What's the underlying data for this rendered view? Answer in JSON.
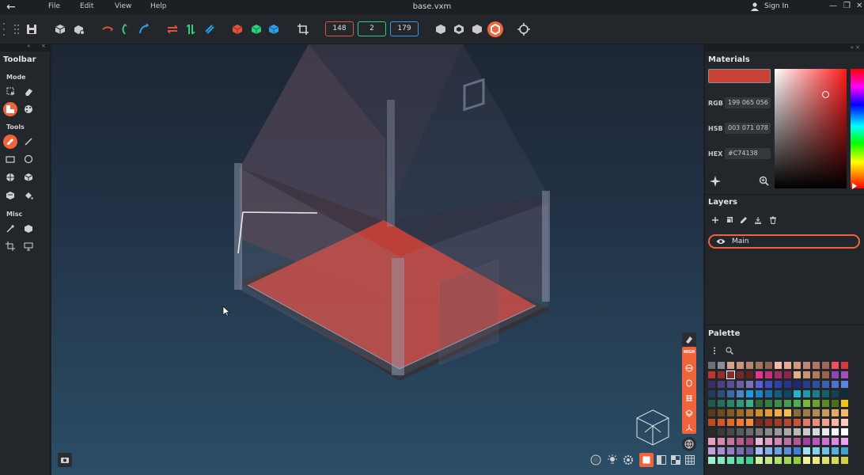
{
  "app": {
    "title": "base.vxm",
    "menu": [
      "File",
      "Edit",
      "View",
      "Help"
    ],
    "signin_label": "Sign In"
  },
  "top_toolbar": {
    "dims": {
      "x": "148",
      "y": "2",
      "z": "179"
    },
    "dim_colors": {
      "x": "#e0533a",
      "y": "#2fcf7c",
      "z": "#2f9ee8"
    }
  },
  "left_toolbar": {
    "heading": "Toolbar",
    "sections": {
      "mode": "Mode",
      "tools": "Tools",
      "misc": "Misc"
    }
  },
  "materials": {
    "heading": "Materials",
    "current_color": "#C74138",
    "rgb_label": "RGB",
    "rgb_value": "199 065 056",
    "hsb_label": "HSB",
    "hsb_value": "003 071 078",
    "hex_label": "HEX",
    "hex_value": "#C74138"
  },
  "layers": {
    "heading": "Layers",
    "items": [
      {
        "name": "Main"
      }
    ]
  },
  "palette": {
    "heading": "Palette",
    "selected_index": 17,
    "colors": [
      "#6b6f78",
      "#8a8d94",
      "#d1a38c",
      "#c8947c",
      "#b9846e",
      "#a37560",
      "#8f6653",
      "#f2b9a6",
      "#e9a890",
      "#d59780",
      "#c18671",
      "#ae7763",
      "#9b6957",
      "#ef4e5a",
      "#d9383e",
      "#c0342f",
      "#9a2c2a",
      "#8a2a2a",
      "#7a2626",
      "#652020",
      "#e8338d",
      "#c82f78",
      "#a82b64",
      "#8a2552",
      "#e0b08a",
      "#c99473",
      "#b17a5c",
      "#99644a",
      "#8e46b4",
      "#a14fb9",
      "#3a2f66",
      "#4a3f7a",
      "#5a4f8e",
      "#6a5fa2",
      "#7d72b6",
      "#5b5fd6",
      "#3e4bc2",
      "#2f40a8",
      "#24358a",
      "#1d2c72",
      "#253d8a",
      "#2e4e9e",
      "#3b5fb2",
      "#4a72c6",
      "#5886da",
      "#233a5c",
      "#2b4d7a",
      "#3a6aa6",
      "#4a85c4",
      "#1d9be0",
      "#1a86c4",
      "#176fa4",
      "#135a86",
      "#0f466a",
      "#26b4c8",
      "#1f98aa",
      "#1a7d8c",
      "#145f6c",
      "#0f4450",
      "#0a2e36",
      "#1c5c4a",
      "#226e58",
      "#2a8468",
      "#329a7a",
      "#3ab08c",
      "#2c6e3a",
      "#347e42",
      "#3c8e4a",
      "#449e52",
      "#4cae5a",
      "#7ab836",
      "#6aa02e",
      "#5a8826",
      "#4a701e",
      "#f2c21e",
      "#5a3a18",
      "#6e4a1e",
      "#845a24",
      "#9a6a2a",
      "#b07a30",
      "#d68a2a",
      "#e39c34",
      "#eeae40",
      "#f6c04e",
      "#8a6a3a",
      "#9e7a44",
      "#b48a4e",
      "#ca9a58",
      "#e0aa62",
      "#f6ba6c",
      "#c04a1c",
      "#d05a24",
      "#e06a2c",
      "#ee7a34",
      "#f68a3c",
      "#7a2a18",
      "#8e3420",
      "#a23e28",
      "#b64830",
      "#ca5238",
      "#e07a66",
      "#e88e7a",
      "#f0a28e",
      "#f8b6a2",
      "#ffcab6",
      "#2a2a2a",
      "#3a3a3a",
      "#4a4a4a",
      "#5a5a5a",
      "#6a6a6a",
      "#7a7a7a",
      "#8a8a8a",
      "#9a9a9a",
      "#aaaaaa",
      "#bababa",
      "#cacaca",
      "#dadada",
      "#eaeaea",
      "#f6f6f6",
      "#ffffff",
      "#e8a0c0",
      "#d88aae",
      "#c8749c",
      "#b85e8a",
      "#a84878",
      "#f0b8d0",
      "#e0a0c0",
      "#d088b0",
      "#c070a0",
      "#b05890",
      "#a040a0",
      "#b858b8",
      "#d070d0",
      "#e088e0",
      "#f0a0f0",
      "#c0a0e0",
      "#a890d0",
      "#9080c0",
      "#7870b0",
      "#6060a0",
      "#a0c0f0",
      "#88b0e8",
      "#70a0e0",
      "#5890d8",
      "#4080d0",
      "#a0e0f0",
      "#88d0e8",
      "#70c0e0",
      "#58b0d8",
      "#40a0d0",
      "#a0f0d0",
      "#88e8c0",
      "#70e0b0",
      "#58d8a0",
      "#40d090",
      "#d0f0a0",
      "#c0e888",
      "#b0e070",
      "#a0d858",
      "#90d040",
      "#f0f0a0",
      "#e8e888",
      "#e0e070",
      "#d8d858",
      "#d0d040"
    ]
  }
}
